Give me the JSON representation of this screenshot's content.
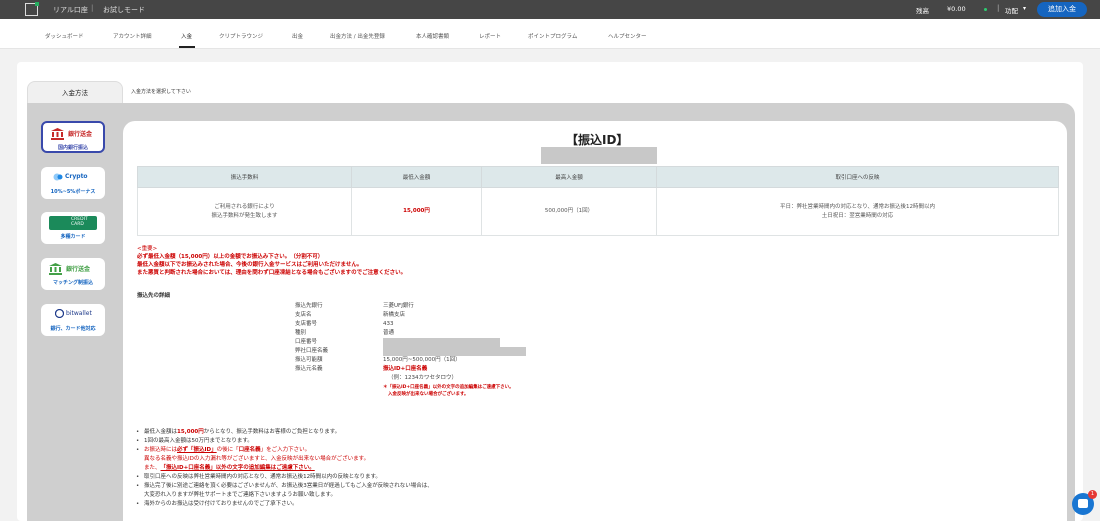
{
  "topbar": {
    "brand": "リアル口座",
    "separator": "|",
    "mode": "お試しモード",
    "balance_label": "残高",
    "balance_value": "¥0.00",
    "func_label": "功配",
    "add_funds_button": "追加入金"
  },
  "nav": {
    "items": [
      "ダッシュボード",
      "アカウント詳細",
      "入金",
      "クリプトラウンジ",
      "出金",
      "出金方法 / 出金先登録",
      "本人確認書類",
      "レポート",
      "ポイントプログラム",
      "ヘルプセンター"
    ],
    "active_index": 2
  },
  "tabs": {
    "active_label": "入金方法",
    "hint": "入金方法を選択して下さい"
  },
  "methods": [
    {
      "name": "銀行送金",
      "sub": "国内銀行振込",
      "selected": true,
      "icon": "bank-icon",
      "color": "#c62828"
    },
    {
      "name": "Crypto",
      "sub": "10%~5%ボーナス",
      "selected": false,
      "icon": "crypto-icon",
      "color": "#1565c0"
    },
    {
      "name": "CREDIT CARD",
      "sub": "多種カード",
      "selected": false,
      "icon": "credit-card-icon",
      "color": "#1b8a5a"
    },
    {
      "name": "銀行送金",
      "sub": "マッチング制振込",
      "selected": false,
      "icon": "bank-icon",
      "color": "#43a047"
    },
    {
      "name": "bitwallet",
      "sub": "銀行、カード他対応",
      "selected": false,
      "icon": "bitwallet-icon",
      "color": "#1e3a8a"
    }
  ],
  "detail": {
    "title": "【振込ID】",
    "table": {
      "headers": [
        "振込手数料",
        "最低入金額",
        "最高入金額",
        "取引口座への反映"
      ],
      "fee": [
        "ご利用される銀行により",
        "振込手数料が発生致します"
      ],
      "min": "15,000円",
      "max": "500,000円（1回）",
      "reflect": [
        "平日：弊社営業時間内の対応となり、通常お振込後12時間以内",
        "土日祝日：翌営業時間の対応"
      ]
    },
    "notice": {
      "heading": "<重要>",
      "line1": "必ず最低入金額（15,000円）以上の金額でお振込み下さい。（分割不可）",
      "line2": "最低入金額以下でお振込みされた場合、今後の銀行入金サービスはご利用いただけません。",
      "line3": "また悪質と判断された場合においては、理由を問わず口座凍結となる場合もございますのでご注意ください。"
    },
    "section_title": "振込先の詳細",
    "rows": [
      {
        "k": "振込先銀行",
        "v": "三菱UFJ銀行"
      },
      {
        "k": "支店名",
        "v": "新橋支店"
      },
      {
        "k": "支店番号",
        "v": "433"
      },
      {
        "k": "種別",
        "v": "普通"
      },
      {
        "k": "口座番号",
        "v": ""
      },
      {
        "k": "弊社口座名義",
        "v": ""
      },
      {
        "k": "振込可能額",
        "v": "15,000円~500,000円（1回）"
      },
      {
        "k": "振込元名義",
        "v": "振込ID+口座名義"
      }
    ],
    "name_example": "（例：1234カワセタロウ）",
    "name_note1": "＊「振込ID+口座名義」以外の文字の追加編集はご遠慮下さい。",
    "name_note2": "入金反映が出来ない場合がございます。",
    "bullets": {
      "b1a": "最低入金額は",
      "b1b": "15,000円",
      "b1c": "からとなり、振込手数料はお客様のご負担となります。",
      "b2": "1回の最高入金額は50万円までとなります。",
      "b3a": "お振込時には",
      "b3b": "必ず「振込ID」",
      "b3c": "の後に「",
      "b3d": "口座名義",
      "b3e": "」をご入力下さい。",
      "b3f": "異なる名義や振込IDの入力漏れ等がございますと、入金反映が出来ない場合がございます。",
      "b3g": "また、",
      "b3h": "「振込ID+口座名義」以外の文字の追加編集はご遠慮下さい。",
      "b4": "取引口座への反映は弊社営業時間内の対応となり、通常お振込後12時間以内の反映となります。",
      "b5a": "振込完了後に別途ご連絡を頂く必要はございませんが、お振込後3営業日が経過してもご入金が反映されない場合は、",
      "b5b": "大変恐れ入りますが弊社サポートまでご連絡下さいますようお願い致します。",
      "b6": "海外からのお振込は受け付けておりませんのでご了承下さい。"
    }
  },
  "chat": {
    "badge": "1"
  }
}
